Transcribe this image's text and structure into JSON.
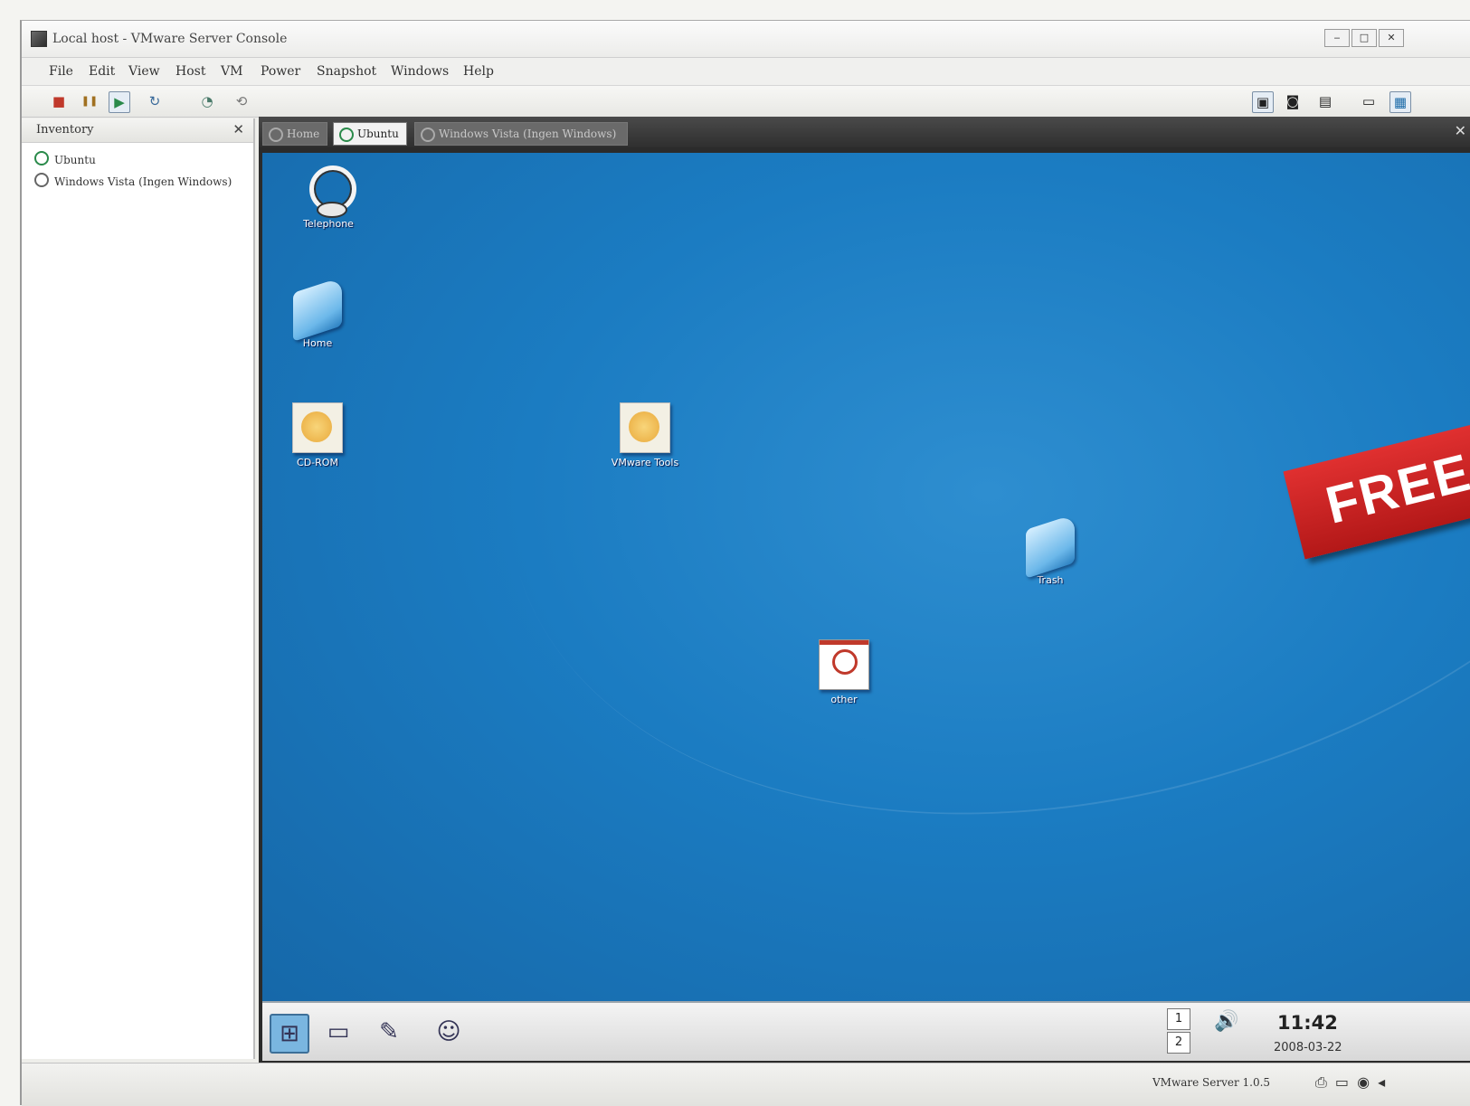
{
  "window": {
    "title": "Local host - VMware Server Console",
    "controls": [
      "‒",
      "□",
      "✕"
    ]
  },
  "menu": [
    "File",
    "Edit",
    "View",
    "Host",
    "VM",
    "Power",
    "Snapshot",
    "Windows",
    "Help"
  ],
  "toolbar": {
    "buttons": [
      {
        "icon": "stop-icon",
        "glyph": "■"
      },
      {
        "icon": "pause-icon",
        "glyph": "❚❚"
      },
      {
        "icon": "play-icon",
        "glyph": "▶"
      },
      {
        "icon": "reset-icon",
        "glyph": "↻"
      },
      {
        "icon": "snapshot-icon",
        "glyph": "◔"
      },
      {
        "icon": "revert-icon",
        "glyph": "⟲"
      }
    ],
    "right_buttons": [
      {
        "icon": "fullscreen-icon",
        "glyph": "▣"
      },
      {
        "icon": "quick-switch-icon",
        "glyph": "◙"
      },
      {
        "icon": "summary-icon",
        "glyph": "▤"
      },
      {
        "icon": "appliance-view-icon",
        "glyph": "▭"
      },
      {
        "icon": "console-view-icon",
        "glyph": "▦"
      }
    ]
  },
  "sidebar": {
    "title": "Inventory",
    "close": "✕",
    "items": [
      {
        "label": "Ubuntu",
        "state": "on"
      },
      {
        "label": "Windows Vista (Ingen Windows)",
        "state": "off"
      }
    ]
  },
  "tabs": [
    {
      "label": "Home",
      "style": "faded"
    },
    {
      "label": "Ubuntu",
      "style": "active"
    },
    {
      "label": "Windows Vista (Ingen Windows)",
      "style": "faded"
    }
  ],
  "desktop": {
    "icons": [
      {
        "name": "phone-app-icon",
        "kind": "phone",
        "caption": "Telephone"
      },
      {
        "name": "home-folder-icon",
        "kind": "folder",
        "caption": "Home"
      },
      {
        "name": "disc-icon-1",
        "kind": "disc",
        "caption": "CD-ROM"
      },
      {
        "name": "vmware-tools-icon",
        "kind": "disc",
        "caption": "VMware Tools"
      },
      {
        "name": "trash-folder-icon",
        "kind": "folder",
        "caption": "Trash"
      },
      {
        "name": "other-file-icon",
        "kind": "other",
        "caption": "other"
      }
    ],
    "banner": "FREE"
  },
  "taskbar": {
    "icons": [
      {
        "name": "start-menu-icon",
        "glyph": "⊞"
      },
      {
        "name": "terminal-icon",
        "glyph": "▭"
      },
      {
        "name": "browser-icon",
        "glyph": "✎"
      },
      {
        "name": "people-icon",
        "glyph": "☺"
      }
    ],
    "pager": [
      "1",
      "2"
    ],
    "tray_glyph": "🔊",
    "time": "11:42",
    "date": "2008-03-22"
  },
  "status": {
    "text": "VMware Server 1.0.5",
    "icons": "⎙ ▭ ◉ ◂"
  }
}
